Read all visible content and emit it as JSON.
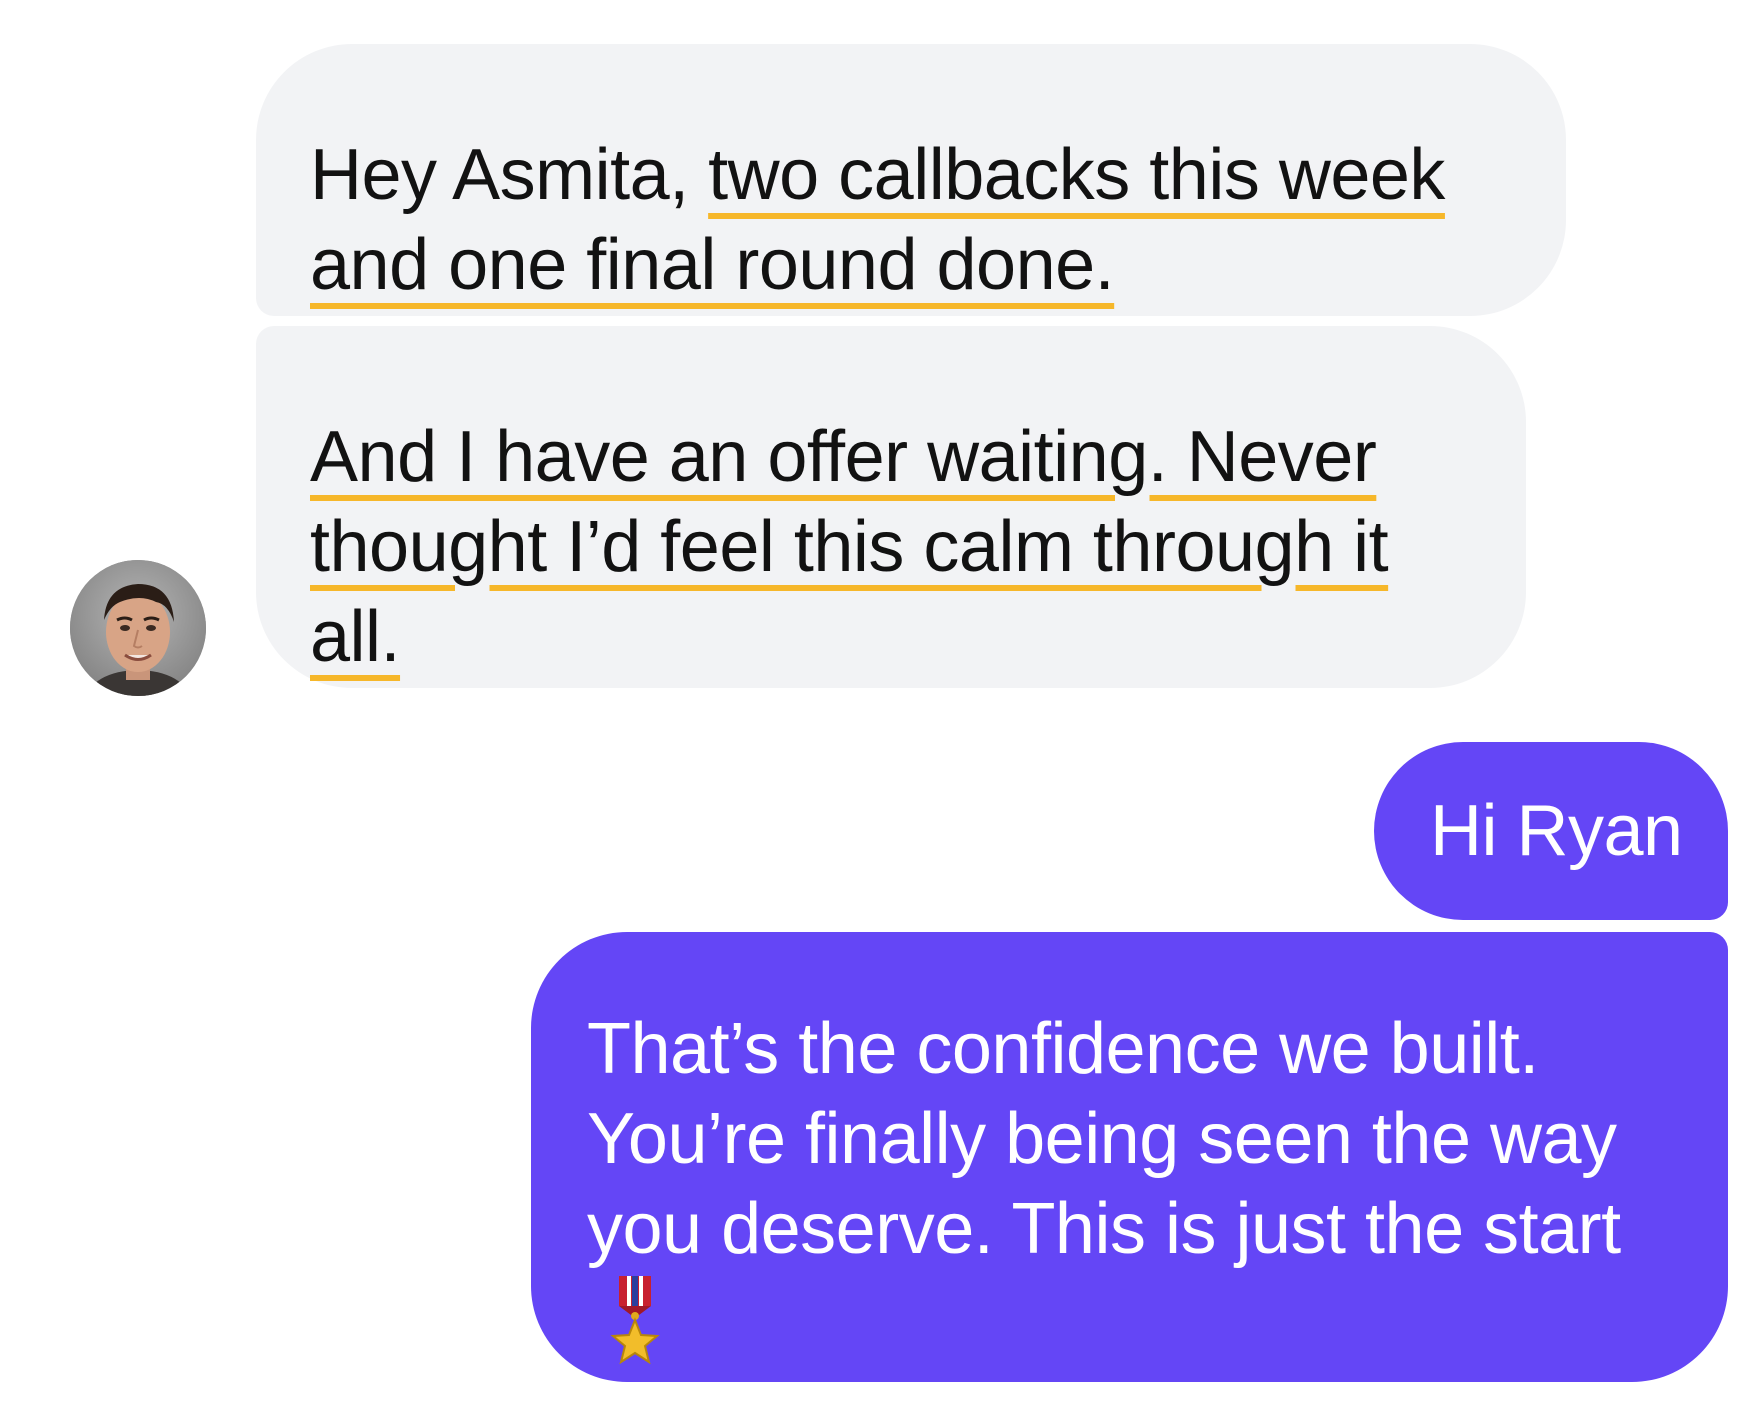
{
  "conversation": {
    "incoming": {
      "bubble_1": {
        "line_1_plain": "Hey Asmita, ",
        "line_1_highlight": "two callbacks this week",
        "line_2_highlight": "and one final round done."
      },
      "bubble_2": {
        "line_1_highlight": "And I have an offer waiting. Never",
        "line_2_highlight": "thought I’d feel this calm through it",
        "line_3_highlight": "all."
      }
    },
    "outgoing": {
      "bubble_3": {
        "text": "Hi Ryan"
      },
      "bubble_4": {
        "line_1": "That’s the confidence we built.",
        "line_2": "You’re finally being seen the way",
        "line_3": "you deserve. This is just the start",
        "emoji_icon": "military-medal-icon"
      }
    }
  },
  "colors": {
    "incoming_bubble": "#f2f3f5",
    "outgoing_bubble": "#6446f6",
    "highlight_underline": "#f6b72a"
  }
}
